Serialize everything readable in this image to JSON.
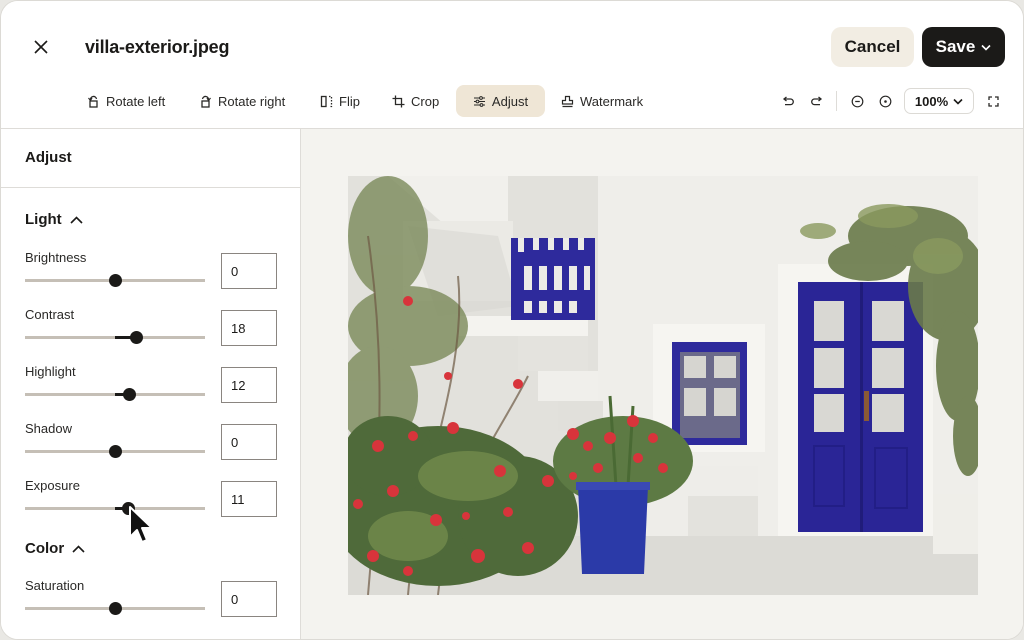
{
  "header": {
    "filename": "villa-exterior.jpeg",
    "cancel_label": "Cancel",
    "save_label": "Save"
  },
  "toolbar": {
    "tools": [
      {
        "label": "Rotate left",
        "icon": "rotate-left-icon"
      },
      {
        "label": "Rotate right",
        "icon": "rotate-right-icon"
      },
      {
        "label": "Flip",
        "icon": "flip-icon"
      },
      {
        "label": "Crop",
        "icon": "crop-icon"
      },
      {
        "label": "Adjust",
        "icon": "sliders-icon",
        "active": true
      },
      {
        "label": "Watermark",
        "icon": "stamp-icon"
      }
    ],
    "zoom_level": "100%"
  },
  "sidebar": {
    "title": "Adjust",
    "sections": [
      {
        "title": "Light",
        "expanded": true,
        "controls": [
          {
            "label": "Brightness",
            "value": "0"
          },
          {
            "label": "Contrast",
            "value": "18"
          },
          {
            "label": "Highlight",
            "value": "12"
          },
          {
            "label": "Shadow",
            "value": "0"
          },
          {
            "label": "Exposure",
            "value": "11"
          }
        ]
      },
      {
        "title": "Color",
        "expanded": true,
        "controls": [
          {
            "label": "Saturation",
            "value": "0"
          }
        ]
      }
    ]
  },
  "colors": {
    "accent_active": "#efe6d6",
    "cancel_bg": "#f2ede3",
    "save_bg": "#1b1a18",
    "door_blue": "#2a2596",
    "geranium_red": "#d8343b"
  },
  "canvas": {
    "image_description": "Whitewashed villa with blue gate, blue window, blue double door, and red geraniums in a blue pot"
  }
}
